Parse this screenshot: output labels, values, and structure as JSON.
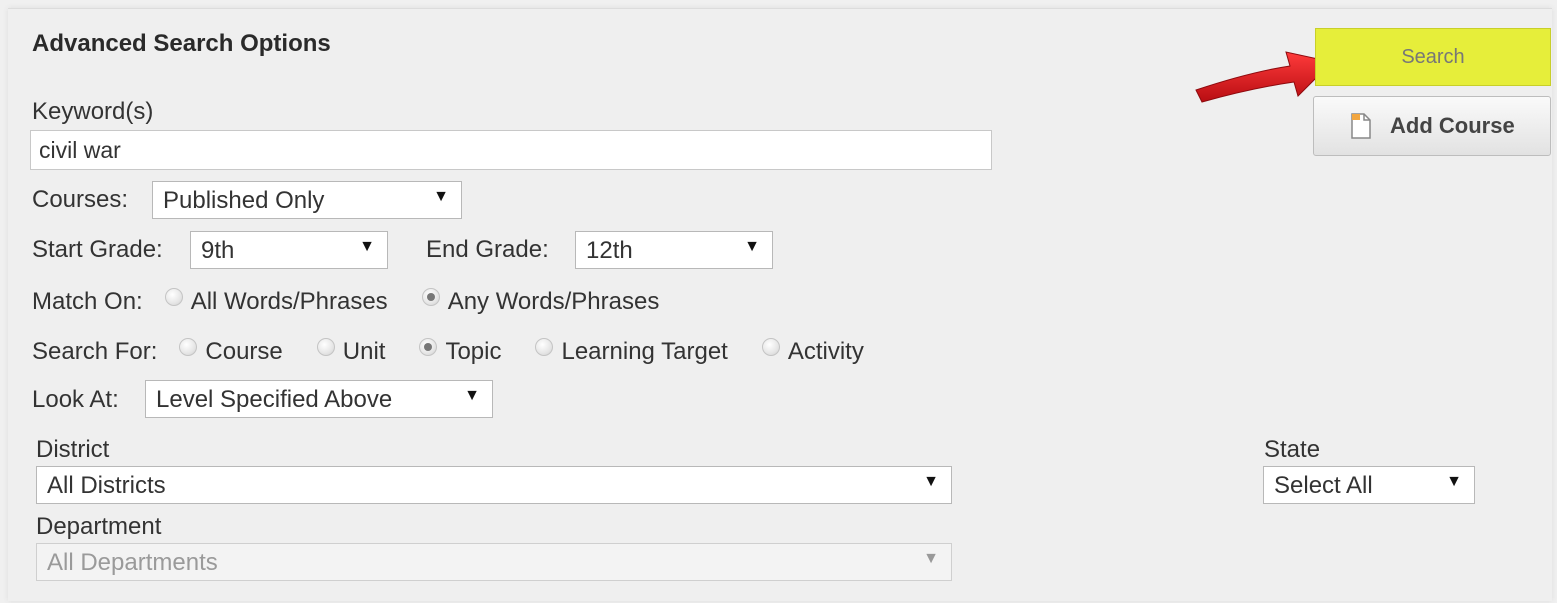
{
  "header": {
    "title": "Advanced Search Options"
  },
  "buttons": {
    "search": "Search",
    "add_course": "Add Course"
  },
  "keyword": {
    "label": "Keyword(s)",
    "value": "civil war"
  },
  "courses": {
    "label": "Courses:",
    "selected": "Published Only"
  },
  "start_grade": {
    "label": "Start Grade:",
    "selected": "9th"
  },
  "end_grade": {
    "label": "End Grade:",
    "selected": "12th"
  },
  "match_on": {
    "label": "Match On:",
    "options": [
      {
        "label": "All Words/Phrases",
        "checked": false
      },
      {
        "label": "Any Words/Phrases",
        "checked": true
      }
    ]
  },
  "search_for": {
    "label": "Search For:",
    "options": [
      {
        "label": "Course",
        "checked": false
      },
      {
        "label": "Unit",
        "checked": false
      },
      {
        "label": "Topic",
        "checked": true
      },
      {
        "label": "Learning Target",
        "checked": false
      },
      {
        "label": "Activity",
        "checked": false
      }
    ]
  },
  "look_at": {
    "label": "Look At:",
    "selected": "Level Specified Above"
  },
  "district": {
    "label": "District",
    "selected": "All Districts"
  },
  "department": {
    "label": "Department",
    "selected": "All Departments",
    "disabled": true
  },
  "state": {
    "label": "State",
    "selected": "Select All"
  },
  "colors": {
    "search_highlight": "#e6ee3a",
    "arrow": "#d8141b"
  },
  "icons": {
    "caret": "▼",
    "add_course_icon": "document-icon",
    "pointer": "red-arrow-icon"
  }
}
